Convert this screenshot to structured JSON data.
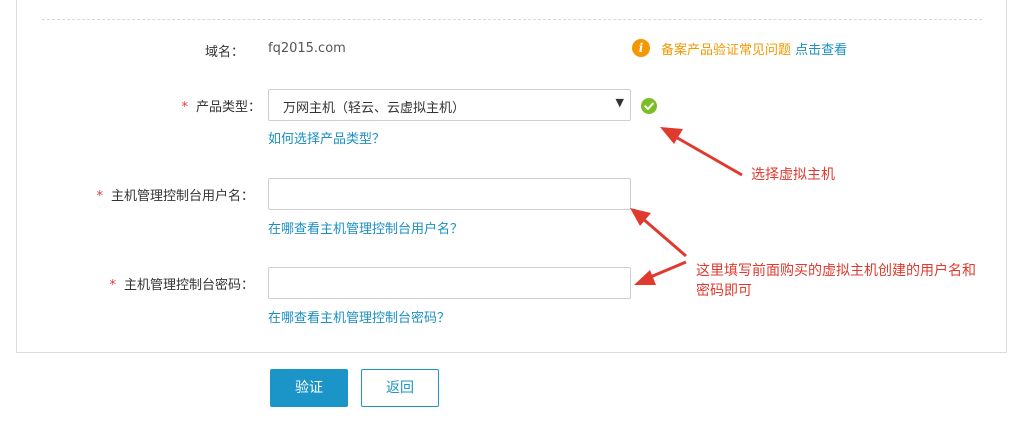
{
  "domain": {
    "label": "域名：",
    "value": "fq2015.com"
  },
  "notice": {
    "text": "备案产品验证常见问题",
    "link": "点击查看"
  },
  "product_type": {
    "required": "*",
    "label": "产品类型：",
    "selected": "万网主机（轻云、云虚拟主机）",
    "arrow": "▼",
    "help": "如何选择产品类型？"
  },
  "username": {
    "required": "*",
    "label": "主机管理控制台用户名：",
    "value": "",
    "help": "在哪查看主机管理控制台用户名？"
  },
  "password": {
    "required": "*",
    "label": "主机管理控制台密码：",
    "value": "",
    "help": "在哪查看主机管理控制台密码？"
  },
  "annotations": {
    "select_note": "选择虚拟主机",
    "credentials_note_line1": "这里填写前面购买的虚拟主机创建的用户名和",
    "credentials_note_line2": "密码即可"
  },
  "buttons": {
    "verify": "验证",
    "back": "返回"
  },
  "colors": {
    "accent": "#1b94c8",
    "link": "#1a8fc2",
    "warning": "#f39800",
    "success": "#7cbc25",
    "required": "#e4393c",
    "annotation": "#e03a2e"
  },
  "icons": {
    "info": "info-icon",
    "valid": "check-circle-icon",
    "dropdown": "caret-down-icon"
  }
}
